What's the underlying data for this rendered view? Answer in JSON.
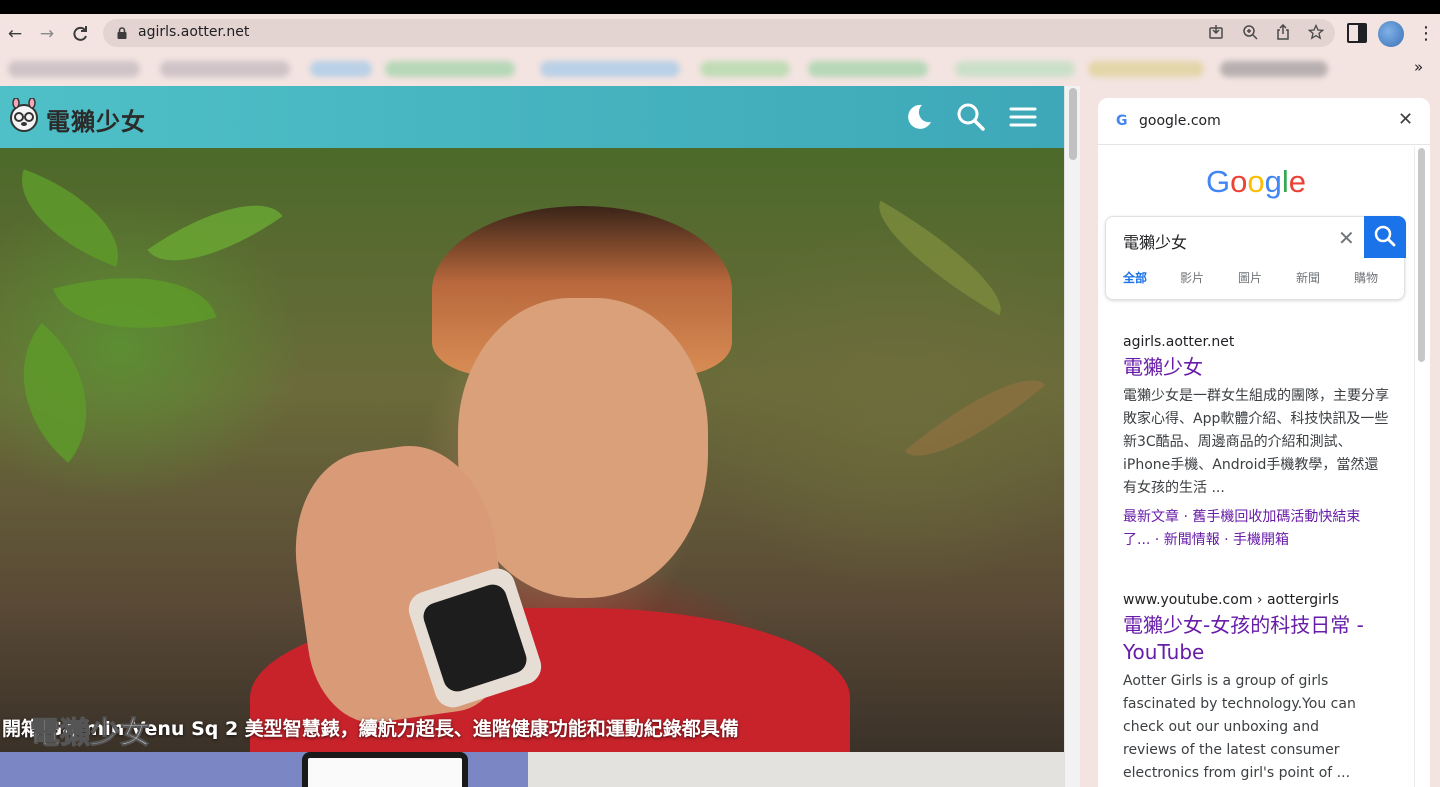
{
  "browser": {
    "url": "agirls.aotter.net",
    "back_icon": "←",
    "forward_icon": "→",
    "reload_icon": "C",
    "menu_icon": "⋮",
    "bookmarks_more": "»"
  },
  "site": {
    "name": "電獺少女",
    "accent_color": "#3ea8b8",
    "hero_caption": "開箱 Garmin Venu Sq 2 美型智慧錶，續航力超長、進階健康功能和運動紀錄都具備",
    "watermark": "電獺少女"
  },
  "side_panel": {
    "domain": "google.com",
    "favicon": "G",
    "close_icon": "✕",
    "logo_letters": [
      {
        "char": "G",
        "color": "#4285f4"
      },
      {
        "char": "o",
        "color": "#ea4335"
      },
      {
        "char": "o",
        "color": "#fbbc05"
      },
      {
        "char": "g",
        "color": "#4285f4"
      },
      {
        "char": "l",
        "color": "#34a853"
      },
      {
        "char": "e",
        "color": "#ea4335"
      }
    ],
    "search": {
      "query": "電獺少女",
      "clear_icon": "✕",
      "tabs": [
        "全部",
        "影片",
        "圖片",
        "新聞",
        "購物"
      ]
    },
    "results": [
      {
        "url": "agirls.aotter.net",
        "title": "電獺少女",
        "snippet": "電獺少女是一群女生組成的團隊，主要分享敗家心得、App軟體介紹、科技快訊及一些新3C酷品、周邊商品的介紹和測試、iPhone手機、Android手機教學，當然還有女孩的生活 ...",
        "links": "最新文章 · 舊手機回收加碼活動快結束了... · 新聞情報 · 手機開箱"
      },
      {
        "url": "www.youtube.com › aottergirls",
        "title": "電獺少女-女孩的科技日常 - YouTube",
        "snippet": "Aotter Girls is a group of girls fascinated by technology.You can check out our unboxing and reviews of the latest consumer electronics from girl's point of ..."
      }
    ]
  }
}
